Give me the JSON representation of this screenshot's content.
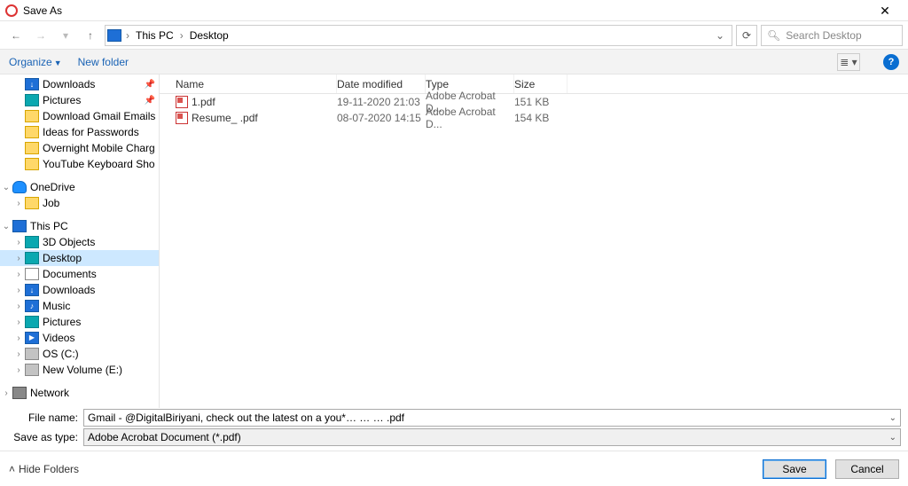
{
  "title": "Save As",
  "breadcrumb": {
    "root": "This PC",
    "current": "Desktop"
  },
  "search": {
    "placeholder": "Search Desktop"
  },
  "toolbar": {
    "organize": "Organize",
    "newfolder": "New folder"
  },
  "help_label": "?",
  "tree": {
    "quick": [
      {
        "label": "Downloads",
        "pinned": true
      },
      {
        "label": "Pictures",
        "pinned": true
      },
      {
        "label": "Download Gmail Emails"
      },
      {
        "label": "Ideas for Passwords"
      },
      {
        "label": "Overnight Mobile Chargin"
      },
      {
        "label": "YouTube Keyboard Shortcu"
      }
    ],
    "onedrive": {
      "label": "OneDrive",
      "child": "Job"
    },
    "thispc": {
      "label": "This PC",
      "children": [
        {
          "label": "3D Objects"
        },
        {
          "label": "Desktop",
          "selected": true
        },
        {
          "label": "Documents"
        },
        {
          "label": "Downloads"
        },
        {
          "label": "Music"
        },
        {
          "label": "Pictures"
        },
        {
          "label": "Videos"
        },
        {
          "label": "OS (C:)"
        },
        {
          "label": "New Volume (E:)"
        }
      ]
    },
    "network": "Network"
  },
  "columns": {
    "name": "Name",
    "date": "Date modified",
    "type": "Type",
    "size": "Size"
  },
  "files": [
    {
      "name": "1.pdf",
      "date": "19-11-2020 21:03",
      "type": "Adobe Acrobat D...",
      "size": "151 KB"
    },
    {
      "name": "Resume_            .pdf",
      "date": "08-07-2020 14:15",
      "type": "Adobe Acrobat D...",
      "size": "154 KB"
    }
  ],
  "form": {
    "filename_label": "File name:",
    "filename_value": "Gmail - @DigitalBiriyani, check out the latest on a you*… … … .pdf",
    "saveas_label": "Save as type:",
    "saveas_value": "Adobe Acrobat Document (*.pdf)"
  },
  "footer": {
    "hide": "Hide Folders",
    "save": "Save",
    "cancel": "Cancel"
  }
}
